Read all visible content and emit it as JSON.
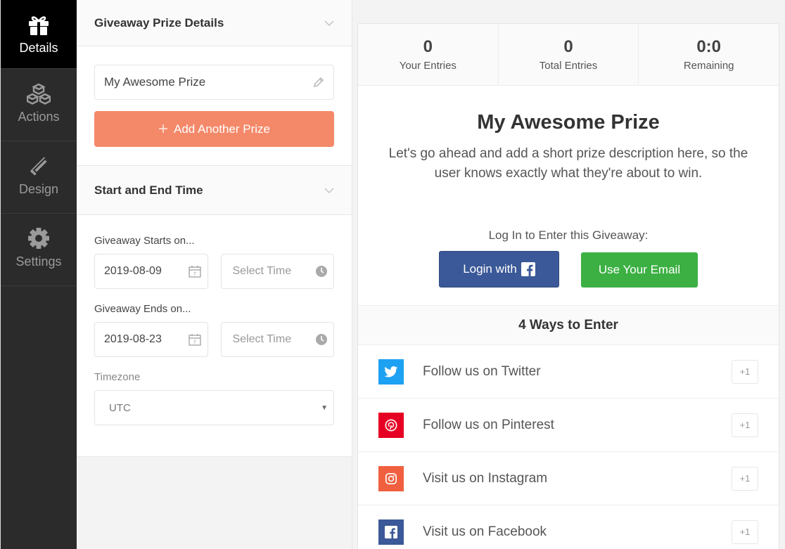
{
  "nav": {
    "items": [
      {
        "label": "Details",
        "icon": "gift-icon"
      },
      {
        "label": "Actions",
        "icon": "cubes-icon"
      },
      {
        "label": "Design",
        "icon": "pencil-ruler-icon"
      },
      {
        "label": "Settings",
        "icon": "gear-icon"
      }
    ]
  },
  "panel": {
    "prize_section_title": "Giveaway Prize Details",
    "prize_name": "My Awesome Prize",
    "add_prize_label": "Add Another Prize",
    "time_section_title": "Start and End Time",
    "starts_label": "Giveaway Starts on...",
    "start_date": "2019-08-09",
    "start_time_placeholder": "Select Time",
    "ends_label": "Giveaway Ends on...",
    "end_date": "2019-08-23",
    "end_time_placeholder": "Select Time",
    "timezone_label": "Timezone",
    "timezone_value": "UTC"
  },
  "preview": {
    "stats": [
      {
        "value": "0",
        "caption": "Your Entries"
      },
      {
        "value": "0",
        "caption": "Total Entries"
      },
      {
        "value": "0:0",
        "caption": "Remaining"
      }
    ],
    "title": "My Awesome Prize",
    "description": "Let's go ahead and add a short prize description here, so the user knows exactly what they're about to win.",
    "login_label": "Log In to Enter this Giveaway:",
    "login_fb_label": "Login with",
    "login_email_label": "Use Your Email",
    "ways_title": "4 Ways to Enter",
    "entries": [
      {
        "label": "Follow us on Twitter",
        "points": "+1",
        "color": "#1da1f2",
        "icon": "twitter-icon"
      },
      {
        "label": "Follow us on Pinterest",
        "points": "+1",
        "color": "#e60023",
        "icon": "pinterest-icon"
      },
      {
        "label": "Visit us on Instagram",
        "points": "+1",
        "color": "#f0603f",
        "icon": "instagram-icon"
      },
      {
        "label": "Visit us on Facebook",
        "points": "+1",
        "color": "#3b5998",
        "icon": "facebook-icon"
      }
    ]
  },
  "colors": {
    "accent_orange": "#f4896a",
    "facebook_blue": "#3b5998",
    "email_green": "#3cb043",
    "nav_dark": "#2b2b2b"
  }
}
